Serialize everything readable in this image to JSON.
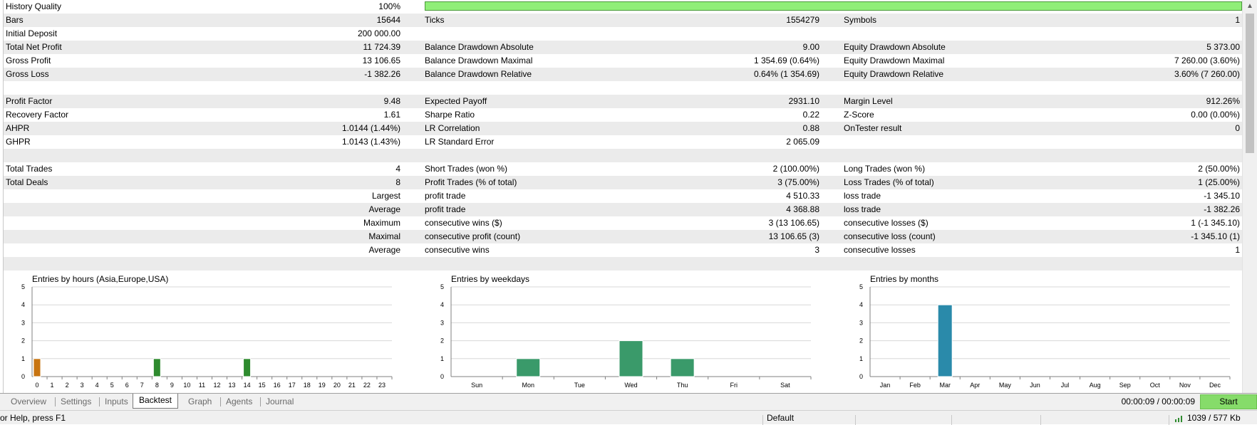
{
  "rows": [
    {
      "alt": false,
      "l1": "History Quality",
      "v1": "100%",
      "quality_bar": true,
      "quality_fraction": 1.0,
      "l2": "",
      "v2": "",
      "l3": "",
      "v3": ""
    },
    {
      "alt": true,
      "l1": "Bars",
      "v1": "15644",
      "l2": "Ticks",
      "v2": "1554279",
      "l3": "Symbols",
      "v3": "1"
    },
    {
      "alt": false,
      "l1": "Initial Deposit",
      "v1": "200 000.00",
      "l2": "",
      "v2": "",
      "l3": "",
      "v3": ""
    },
    {
      "alt": true,
      "l1": "Total Net Profit",
      "v1": "11 724.39",
      "l2": "Balance Drawdown Absolute",
      "v2": "9.00",
      "l3": "Equity Drawdown Absolute",
      "v3": "5 373.00"
    },
    {
      "alt": false,
      "l1": "Gross Profit",
      "v1": "13 106.65",
      "l2": "Balance Drawdown Maximal",
      "v2": "1 354.69 (0.64%)",
      "l3": "Equity Drawdown Maximal",
      "v3": "7 260.00 (3.60%)"
    },
    {
      "alt": true,
      "l1": "Gross Loss",
      "v1": "-1 382.26",
      "l2": "Balance Drawdown Relative",
      "v2": "0.64% (1 354.69)",
      "l3": "Equity Drawdown Relative",
      "v3": "3.60% (7 260.00)"
    },
    {
      "alt": false,
      "l1": "",
      "v1": "",
      "l2": "",
      "v2": "",
      "l3": "",
      "v3": ""
    },
    {
      "alt": true,
      "l1": "Profit Factor",
      "v1": "9.48",
      "l2": "Expected Payoff",
      "v2": "2931.10",
      "l3": "Margin Level",
      "v3": "912.26%"
    },
    {
      "alt": false,
      "l1": "Recovery Factor",
      "v1": "1.61",
      "l2": "Sharpe Ratio",
      "v2": "0.22",
      "l3": "Z-Score",
      "v3": "0.00 (0.00%)"
    },
    {
      "alt": true,
      "l1": "AHPR",
      "v1": "1.0144 (1.44%)",
      "l2": "LR Correlation",
      "v2": "0.88",
      "l3": "OnTester result",
      "v3": "0"
    },
    {
      "alt": false,
      "l1": "GHPR",
      "v1": "1.0143 (1.43%)",
      "l2": "LR Standard Error",
      "v2": "2 065.09",
      "l3": "",
      "v3": ""
    },
    {
      "alt": true,
      "l1": "",
      "v1": "",
      "l2": "",
      "v2": "",
      "l3": "",
      "v3": ""
    },
    {
      "alt": false,
      "l1": "Total Trades",
      "v1": "4",
      "l2": "Short Trades (won %)",
      "v2": "2 (100.00%)",
      "l3": "Long Trades (won %)",
      "v3": "2 (50.00%)"
    },
    {
      "alt": true,
      "l1": "Total Deals",
      "v1": "8",
      "l2": "Profit Trades (% of total)",
      "v2": "3 (75.00%)",
      "l3": "Loss Trades (% of total)",
      "v3": "1 (25.00%)"
    },
    {
      "alt": false,
      "l1": "",
      "v1": "Largest",
      "l2": "profit trade",
      "v2": "4 510.33",
      "l3": "loss trade",
      "v3": "-1 345.10"
    },
    {
      "alt": true,
      "l1": "",
      "v1": "Average",
      "l2": "profit trade",
      "v2": "4 368.88",
      "l3": "loss trade",
      "v3": "-1 382.26"
    },
    {
      "alt": false,
      "l1": "",
      "v1": "Maximum",
      "l2": "consecutive wins ($)",
      "v2": "3 (13 106.65)",
      "l3": "consecutive losses ($)",
      "v3": "1 (-1 345.10)"
    },
    {
      "alt": true,
      "l1": "",
      "v1": "Maximal",
      "l2": "consecutive profit (count)",
      "v2": "13 106.65 (3)",
      "l3": "consecutive loss (count)",
      "v3": "-1 345.10 (1)"
    },
    {
      "alt": false,
      "l1": "",
      "v1": "Average",
      "l2": "consecutive wins",
      "v2": "3",
      "l3": "consecutive losses",
      "v3": "1"
    },
    {
      "alt": true,
      "l1": "",
      "v1": "",
      "l2": "",
      "v2": "",
      "l3": "",
      "v3": ""
    }
  ],
  "colors": {
    "quality_fill": "#90ee78",
    "bar_short": "#c87410",
    "bar_green": "#2e8b2e",
    "bar_weekday": "#3a9a6a",
    "bar_month": "#2a8aaa",
    "start_button": "#86dc6a"
  },
  "chart_data": [
    {
      "type": "bar",
      "title": "Entries by hours (Asia,Europe,USA)",
      "categories": [
        "0",
        "1",
        "2",
        "3",
        "4",
        "5",
        "6",
        "7",
        "8",
        "9",
        "10",
        "11",
        "12",
        "13",
        "14",
        "15",
        "16",
        "17",
        "18",
        "19",
        "20",
        "21",
        "22",
        "23"
      ],
      "series": [
        {
          "values": [
            1,
            0,
            0,
            0,
            0,
            0,
            0,
            0,
            0,
            0,
            0,
            0,
            0,
            0,
            0,
            0,
            0,
            0,
            0,
            0,
            0,
            0,
            0,
            0
          ],
          "color": "#c87410"
        },
        {
          "values": [
            0,
            0,
            0,
            0,
            0,
            0,
            0,
            0,
            1,
            0,
            0,
            0,
            0,
            0,
            1,
            0,
            0,
            0,
            0,
            0,
            0,
            0,
            0,
            0
          ],
          "color": "#2e8b2e"
        }
      ],
      "ylim": [
        0,
        5
      ],
      "yticks": [
        "0",
        "1",
        "2",
        "3",
        "4",
        "5"
      ],
      "grid": true
    },
    {
      "type": "bar",
      "title": "Entries by weekdays",
      "categories": [
        "Sun",
        "Mon",
        "Tue",
        "Wed",
        "Thu",
        "Fri",
        "Sat"
      ],
      "series": [
        {
          "values": [
            0,
            1,
            0,
            2,
            1,
            0,
            0
          ],
          "color": "#3a9a6a"
        }
      ],
      "ylim": [
        0,
        5
      ],
      "yticks": [
        "0",
        "1",
        "2",
        "3",
        "4",
        "5"
      ],
      "grid": true
    },
    {
      "type": "bar",
      "title": "Entries by months",
      "categories": [
        "Jan",
        "Feb",
        "Mar",
        "Apr",
        "May",
        "Jun",
        "Jul",
        "Aug",
        "Sep",
        "Oct",
        "Nov",
        "Dec"
      ],
      "series": [
        {
          "values": [
            0,
            0,
            4,
            0,
            0,
            0,
            0,
            0,
            0,
            0,
            0,
            0
          ],
          "color": "#2a8aaa"
        }
      ],
      "ylim": [
        0,
        5
      ],
      "yticks": [
        "0",
        "1",
        "2",
        "3",
        "4",
        "5"
      ],
      "grid": true
    }
  ],
  "tabs": [
    {
      "label": "Overview",
      "active": false
    },
    {
      "label": "Settings",
      "active": false
    },
    {
      "label": "Inputs",
      "active": false
    },
    {
      "label": "Backtest",
      "active": true
    },
    {
      "label": "Graph",
      "active": false
    },
    {
      "label": "Agents",
      "active": false
    },
    {
      "label": "Journal",
      "active": false
    }
  ],
  "timer": "00:00:09 / 00:00:09",
  "start_label": "Start",
  "status": {
    "help": "or Help, press F1",
    "profile": "Default",
    "traffic": "1039 / 577 Kb",
    "signal_icon": "signal-bars-icon"
  },
  "scroll": {
    "up_icon": "chevron-up-icon"
  }
}
